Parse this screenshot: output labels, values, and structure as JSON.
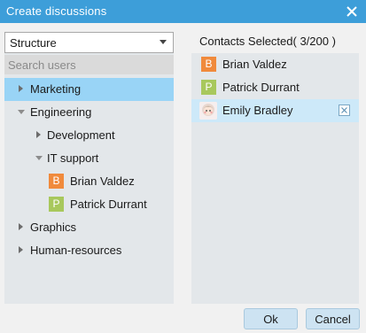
{
  "window": {
    "title": "Create discussions",
    "close_icon": "close-icon"
  },
  "left": {
    "dropdown_value": "Structure",
    "search_placeholder": "Search users",
    "tree": [
      {
        "label": "Marketing",
        "state": "collapsed",
        "selected": true
      },
      {
        "label": "Engineering",
        "state": "expanded"
      },
      {
        "label": "Development",
        "state": "collapsed"
      },
      {
        "label": "IT support",
        "state": "expanded"
      },
      {
        "label": "Brian Valdez",
        "avatar_letter": "B",
        "avatar_color": "#f08a3c"
      },
      {
        "label": "Patrick Durrant",
        "avatar_letter": "P",
        "avatar_color": "#a8c85c"
      },
      {
        "label": "Graphics",
        "state": "collapsed"
      },
      {
        "label": "Human-resources",
        "state": "collapsed"
      }
    ]
  },
  "right": {
    "header": "Contacts Selected( 3/200 )",
    "contacts": [
      {
        "name": "Brian Valdez",
        "avatar_letter": "B",
        "avatar_color": "#f08a3c"
      },
      {
        "name": "Patrick Durrant",
        "avatar_letter": "P",
        "avatar_color": "#a8c85c"
      },
      {
        "name": "Emily Bradley",
        "avatar": "photo",
        "selected": true,
        "remove_icon": "remove-icon"
      }
    ]
  },
  "buttons": {
    "ok": "Ok",
    "cancel": "Cancel"
  },
  "colors": {
    "titlebar": "#3d9ed9",
    "selected_row": "#99d4f6",
    "selected_contact": "#cde9f9",
    "pane_bg": "#e3e7ea",
    "button_bg": "#cde3f2"
  }
}
